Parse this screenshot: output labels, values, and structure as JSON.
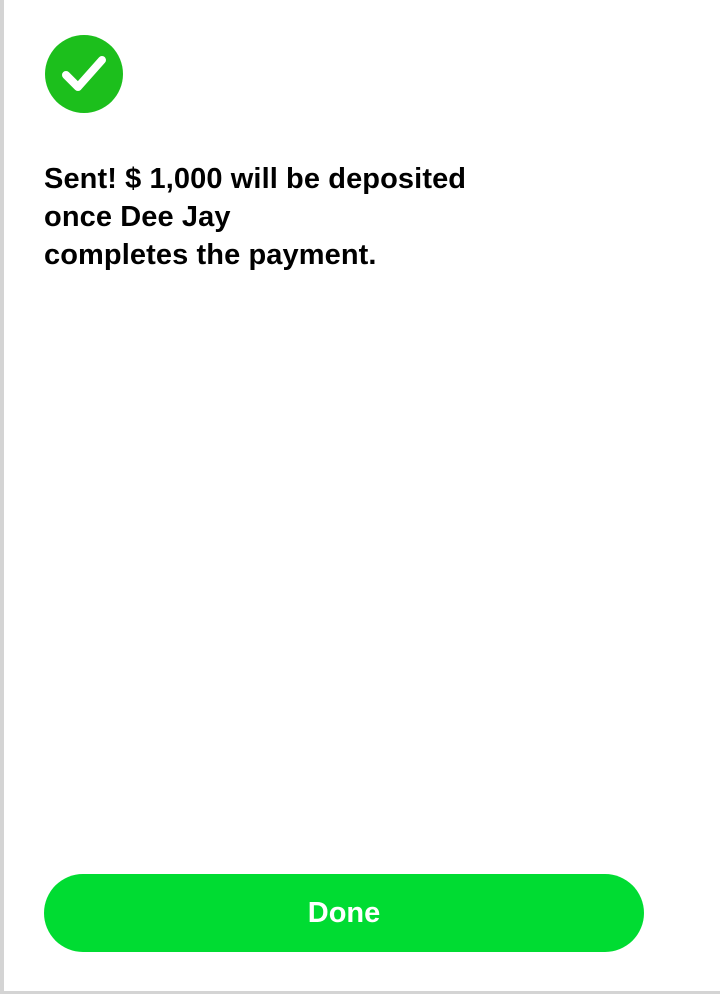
{
  "status": {
    "icon": "check-circle-icon",
    "color": "#1cbf1c"
  },
  "message": {
    "line1": "Sent! $ 1,000 will be deposited",
    "line2": "once Dee Jay",
    "line3": "completes the payment."
  },
  "actions": {
    "done_label": "Done",
    "done_color": "#00dc32"
  }
}
